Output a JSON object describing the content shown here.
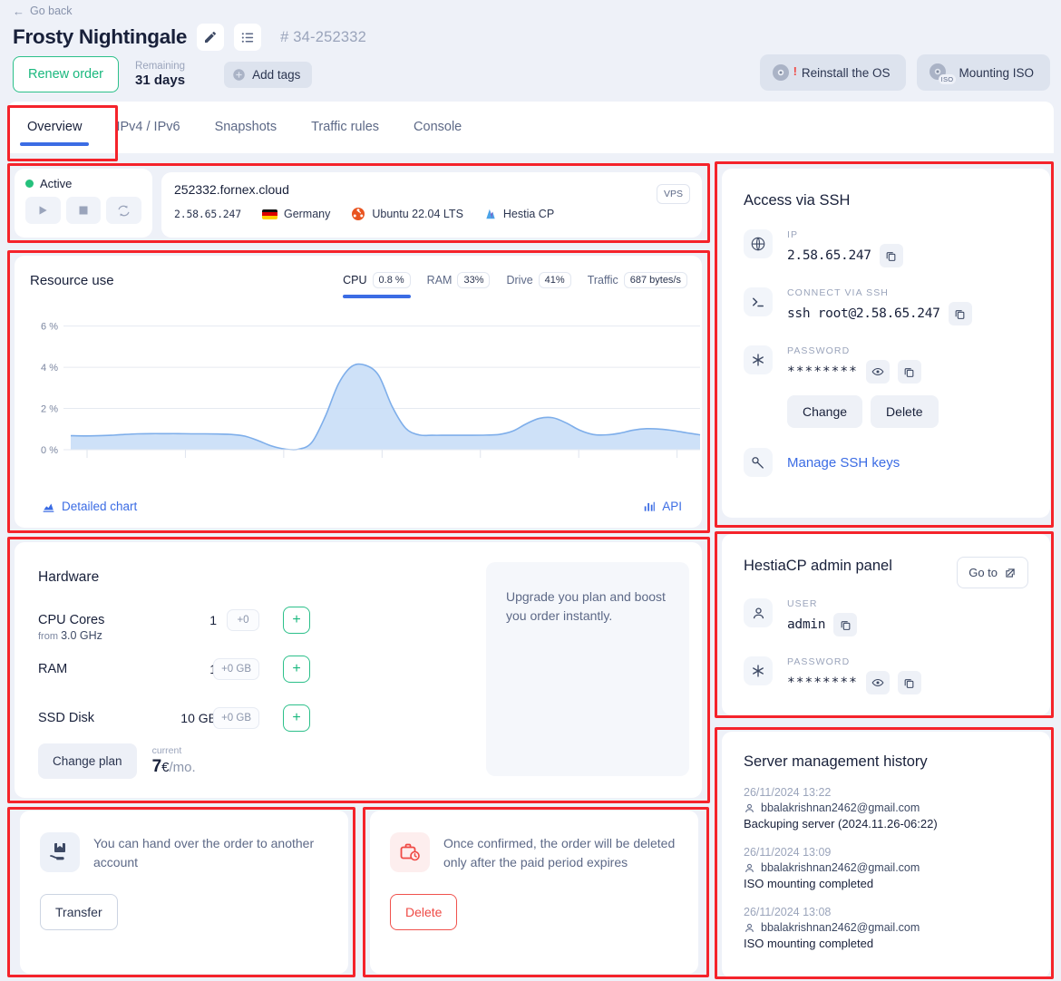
{
  "header": {
    "go_back": "Go back",
    "title": "Frosty Nightingale",
    "order_id": "# 34-252332",
    "renew_label": "Renew order",
    "remaining_label": "Remaining",
    "remaining_value": "31 days",
    "add_tags": "Add tags",
    "reinstall_os": "Reinstall the OS",
    "mounting_iso": "Mounting ISO",
    "iso_badge": "ISO"
  },
  "tabs": [
    {
      "label": "Overview",
      "active": true
    },
    {
      "label": "IPv4 / IPv6",
      "active": false
    },
    {
      "label": "Snapshots",
      "active": false
    },
    {
      "label": "Traffic rules",
      "active": false
    },
    {
      "label": "Console",
      "active": false
    }
  ],
  "status": {
    "label": "Active",
    "color": "#25c17c"
  },
  "server": {
    "hostname": "252332.fornex.cloud",
    "ip": "2.58.65.247",
    "country": "Germany",
    "os": "Ubuntu 22.04 LTS",
    "panel": "Hestia CP",
    "type_badge": "VPS"
  },
  "resource": {
    "title": "Resource use",
    "metrics": [
      {
        "name": "CPU",
        "value": "0.8 %",
        "active": true
      },
      {
        "name": "RAM",
        "value": "33%",
        "active": false
      },
      {
        "name": "Drive",
        "value": "41%",
        "active": false
      },
      {
        "name": "Traffic",
        "value": "687 bytes/s",
        "active": false
      }
    ],
    "detailed_chart": "Detailed chart",
    "api": "API"
  },
  "chart_data": {
    "type": "area",
    "title": "Resource use",
    "series": [
      {
        "name": "CPU",
        "values": [
          0.68,
          0.67,
          0.68,
          0.7,
          0.74,
          0.77,
          0.78,
          0.78,
          0.78,
          0.77,
          0.77,
          0.76,
          0.74,
          0.66,
          0.44,
          0.18,
          0.03,
          0.02,
          0.35,
          1.6,
          3.2,
          4.05,
          4.1,
          3.6,
          2.1,
          1.05,
          0.72,
          0.7,
          0.7,
          0.7,
          0.7,
          0.71,
          0.74,
          0.9,
          1.25,
          1.52,
          1.55,
          1.3,
          0.95,
          0.74,
          0.72,
          0.8,
          0.95,
          1.02,
          1.0,
          0.93,
          0.82,
          0.72
        ]
      }
    ],
    "ytick_labels": [
      "0 %",
      "2 %",
      "4 %",
      "6 %"
    ],
    "ytick_values": [
      0,
      2,
      4,
      6
    ],
    "ylim": [
      0,
      6.6
    ],
    "xlabel": "",
    "ylabel": "",
    "grid": true,
    "legend": false,
    "area_fill": "#c5dcf7",
    "line_color": "#7eaeea"
  },
  "hardware": {
    "title": "Hardware",
    "rows": [
      {
        "name": "CPU Cores",
        "sub_prefix": "from",
        "sub_value": "3.0 GHz",
        "value": "1",
        "delta": "+0",
        "add": "+"
      },
      {
        "name": "RAM",
        "sub_prefix": "",
        "sub_value": "",
        "value": "1",
        "delta": "+0 GB",
        "add": "+"
      },
      {
        "name": "SSD Disk",
        "sub_prefix": "",
        "sub_value": "",
        "value": "10 GB",
        "delta": "+0 GB",
        "add": "+"
      }
    ],
    "change_plan": "Change plan",
    "price_label": "current",
    "price_amount": "7",
    "price_currency": "€",
    "price_period": "/mo.",
    "upgrade_text": "Upgrade you plan and boost you order instantly."
  },
  "transfer": {
    "text": "You can hand over the order to another account",
    "button": "Transfer"
  },
  "delete": {
    "text": "Once confirmed, the order will be deleted only after the paid period expires",
    "button": "Delete"
  },
  "ssh": {
    "title": "Access via SSH",
    "ip_label": "IP",
    "ip_value": "2.58.65.247",
    "connect_label": "CONNECT VIA SSH",
    "connect_value": "ssh root@2.58.65.247",
    "password_label": "PASSWORD",
    "password_value": "********",
    "change_button": "Change",
    "delete_button": "Delete",
    "manage_keys": "Manage SSH keys"
  },
  "hestia": {
    "title": "HestiaCP admin panel",
    "goto": "Go to",
    "user_label": "USER",
    "user_value": "admin",
    "password_label": "PASSWORD",
    "password_value": "********"
  },
  "history": {
    "title": "Server management history",
    "items": [
      {
        "time": "26/11/2024 13:22",
        "user": "bbalakrishnan2462@gmail.com",
        "message": "Backuping server (2024.11.26-06:22)"
      },
      {
        "time": "26/11/2024 13:09",
        "user": "bbalakrishnan2462@gmail.com",
        "message": "ISO mounting completed"
      },
      {
        "time": "26/11/2024 13:08",
        "user": "bbalakrishnan2462@gmail.com",
        "message": "ISO mounting completed"
      }
    ]
  },
  "colors": {
    "accent": "#3b6ce4",
    "green": "#1ab87e",
    "red": "#ef4a45",
    "annotation": "#f5232b"
  }
}
